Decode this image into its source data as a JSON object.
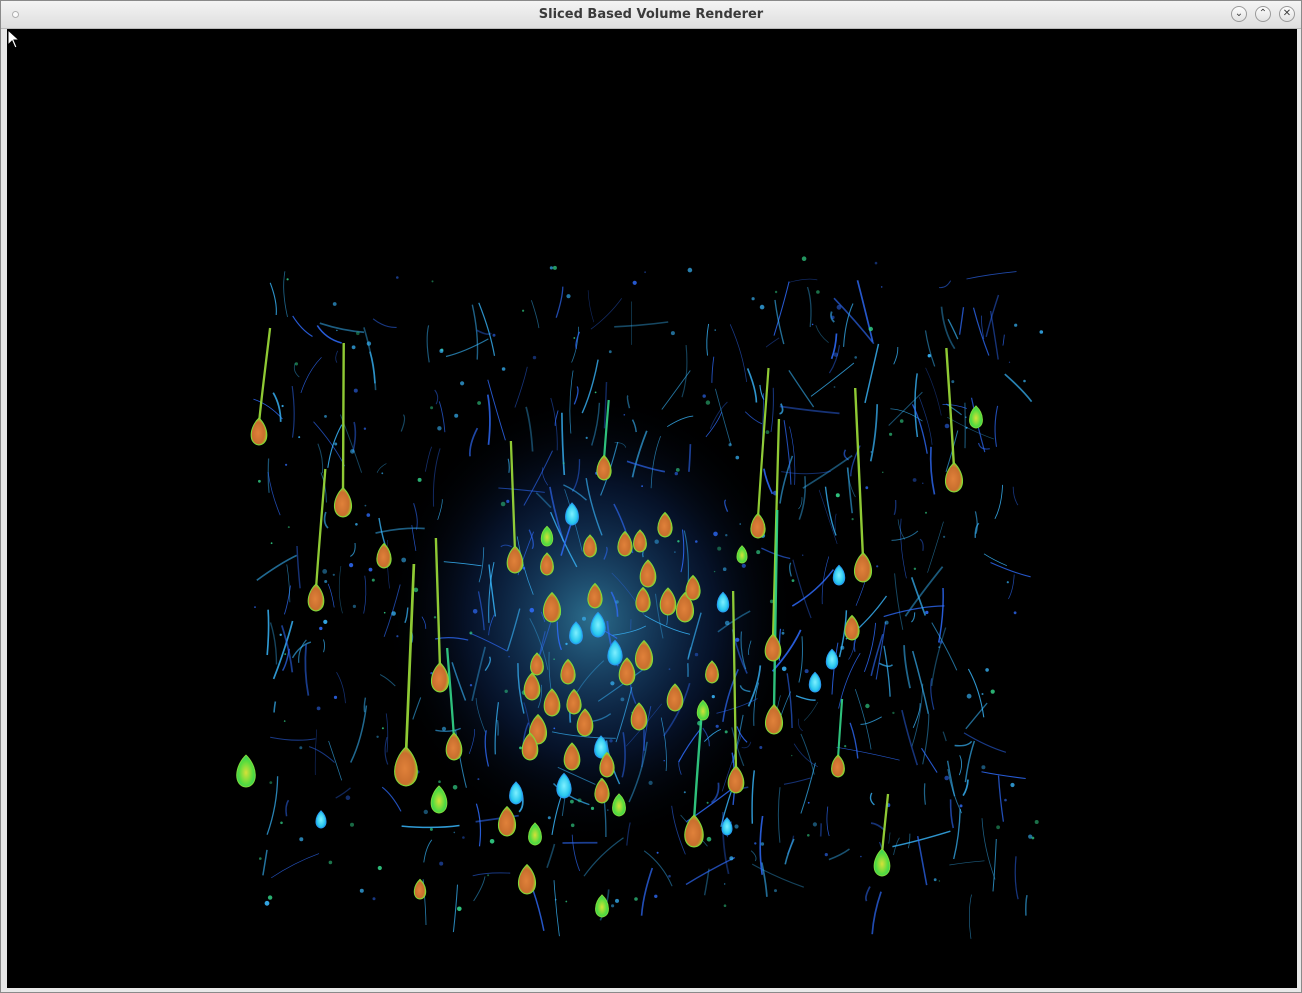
{
  "window": {
    "title": "Sliced Based Volume Renderer",
    "controls": {
      "minimize_glyph": "⌄",
      "maximize_glyph": "⌃",
      "close_glyph": "✕"
    }
  },
  "viewport": {
    "background_color": "#000000",
    "content": "volume-rendered-neurons",
    "soma_colors": [
      "#d9763a",
      "#9fd42c",
      "#27e07a",
      "#32d9f0"
    ],
    "neurite_colors": [
      "#2f6dff",
      "#39b9ff",
      "#33d68a"
    ]
  }
}
